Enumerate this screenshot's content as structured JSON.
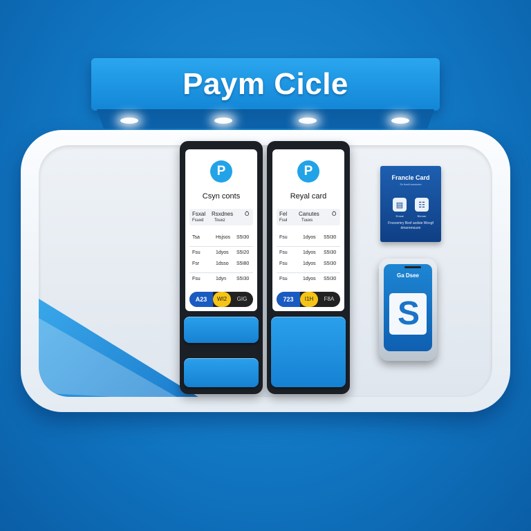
{
  "banner": {
    "title": "Paym Cicle"
  },
  "kiosk_left": {
    "logo": "P",
    "title": "Csyn conts",
    "header": [
      "Fsxal",
      "Rsxdnes",
      "Ö"
    ],
    "header_sub": [
      "Fsuxd",
      "Touxz",
      ""
    ],
    "rows": [
      [
        "Tsa",
        "Hsjsos",
        "S5I30"
      ],
      [
        "Fsu",
        "1dyos",
        "S5I20"
      ],
      [
        "Fsr",
        "1dsso",
        "S5I80"
      ],
      [
        "Fsu",
        "1dyn",
        "S5I30"
      ]
    ],
    "pay": [
      "A23",
      "WI2",
      "GIG"
    ]
  },
  "kiosk_right": {
    "logo": "P",
    "title": "Reyal card",
    "header": [
      "Fel",
      "Canutes",
      "Ö"
    ],
    "header_sub": [
      "Fsul",
      "Tuuxs",
      ""
    ],
    "rows": [
      [
        "Fsu",
        "1dyos",
        "S5I30"
      ],
      [
        "Fsu",
        "1dyos",
        "S5I30"
      ],
      [
        "Fsu",
        "1dyos",
        "S5I30"
      ],
      [
        "Fsu",
        "1dyos",
        "S5I30"
      ]
    ],
    "pay": [
      "723",
      "I1H",
      "F8A"
    ]
  },
  "card": {
    "title": "Francle Card",
    "subtitle": "Sv fuxdi sooxcmn",
    "icons": [
      "card-icon",
      "receipt-icon"
    ],
    "icon_labels": [
      "Erxsai",
      "Bbrxan"
    ],
    "footer": "Frsxoxmry Bxxf acdxie Woxgf dmsrnmxuon"
  },
  "phone": {
    "title": "Ga Dsee",
    "logo": "S"
  },
  "colors": {
    "accent": "#1a86d6",
    "yellow": "#f6c417",
    "navy": "#0f3f85"
  }
}
